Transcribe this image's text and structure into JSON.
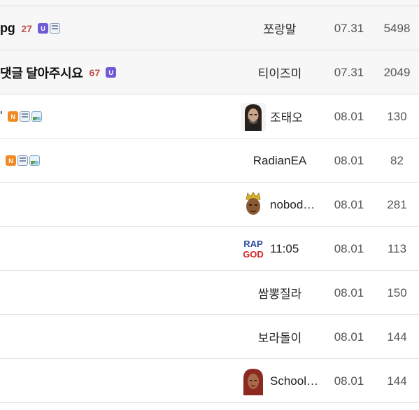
{
  "board": {
    "rows": [
      {
        "title": "pg",
        "bold": true,
        "reply_count": "27",
        "badges": [
          "U",
          "file"
        ],
        "author": "쪼랑말",
        "avatar": "",
        "date": "07.31",
        "views": "5498",
        "notice": true
      },
      {
        "title": "댓글 달아주시요",
        "bold": true,
        "reply_count": "67",
        "badges": [
          "U"
        ],
        "author": "티이즈미",
        "avatar": "",
        "date": "07.31",
        "views": "2049",
        "notice": true
      },
      {
        "title": "'",
        "bold": false,
        "reply_count": "",
        "badges": [
          "N",
          "file",
          "image"
        ],
        "author": "조태오",
        "avatar": "long-hair-man-avatar-icon",
        "date": "08.01",
        "views": "130",
        "notice": false
      },
      {
        "title": "",
        "bold": false,
        "reply_count": "",
        "badges": [
          "N",
          "file",
          "image"
        ],
        "author": "RadianEA",
        "avatar": "",
        "date": "08.01",
        "views": "82",
        "notice": false
      },
      {
        "title": "",
        "bold": false,
        "reply_count": "",
        "badges": [],
        "author": "nobod…",
        "avatar": "crowned-man-avatar-icon",
        "date": "08.01",
        "views": "281",
        "notice": false
      },
      {
        "title": "",
        "bold": false,
        "reply_count": "",
        "badges": [],
        "author": "11:05",
        "avatar": "rap-god-avatar-icon",
        "avatar_text": [
          "RAP",
          "GOD"
        ],
        "date": "08.01",
        "views": "113",
        "notice": false
      },
      {
        "title": "",
        "bold": false,
        "reply_count": "",
        "badges": [],
        "author": "쌈뽕질라",
        "avatar": "",
        "date": "08.01",
        "views": "150",
        "notice": false
      },
      {
        "title": "",
        "bold": false,
        "reply_count": "",
        "badges": [],
        "author": "보라돌이",
        "avatar": "",
        "date": "08.01",
        "views": "144",
        "notice": false
      },
      {
        "title": "",
        "bold": false,
        "reply_count": "",
        "badges": [],
        "author": "School…",
        "avatar": "red-hair-woman-avatar-icon",
        "date": "08.01",
        "views": "144",
        "notice": false
      }
    ]
  },
  "colors": {
    "reply_count": "#c0504d",
    "badge_u": "#6f5bd6",
    "badge_n": "#f08a24",
    "notice_bg": "#f7f7f7"
  }
}
